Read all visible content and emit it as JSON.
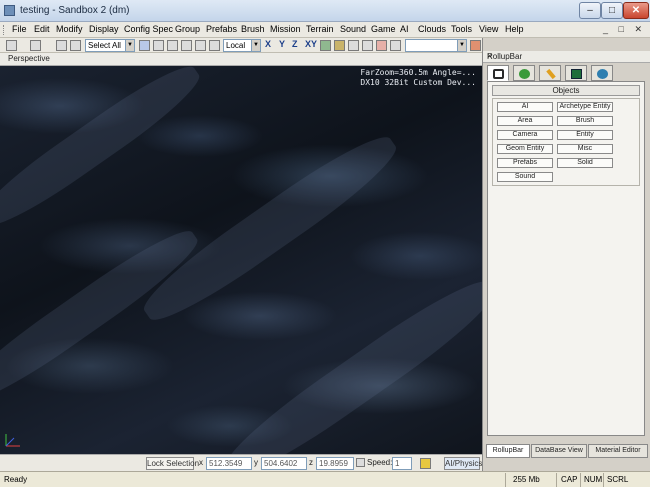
{
  "window": {
    "title": "testing - Sandbox 2 (dm)",
    "min": "–",
    "max": "□",
    "close": "✕"
  },
  "menu": [
    "File",
    "Edit",
    "Modify",
    "Display",
    "Config Spec",
    "Group",
    "Prefabs",
    "Brush",
    "Mission",
    "Terrain",
    "Sound",
    "Game",
    "AI",
    "Clouds",
    "Tools",
    "View",
    "Help"
  ],
  "mdi_buttons": "_ □ ✕",
  "toolbar": {
    "select_combo": "Select All",
    "layer_combo": "Local",
    "axis_x": "X",
    "axis_y": "Y",
    "axis_z": "Z",
    "axis_xy": "XY"
  },
  "viewport": {
    "label": "Perspective",
    "hud_line1": "FarZoom=360.5m  Angle=...",
    "hud_line2": "DX10  32Bit  Custom Dev..."
  },
  "bottombar": {
    "lock_selection": "Lock Selection",
    "x_label": "x",
    "x_value": "512.3549",
    "y_label": "y",
    "y_value": "504.6402",
    "z_label": "z",
    "z_value": "19.8959",
    "speed_label": "Speed:",
    "speed_value": "1",
    "ai_physics": "AI/Physics"
  },
  "status": {
    "ready": "Ready",
    "memory": "255 Mb",
    "cap": "CAP",
    "num": "NUM",
    "scrl": "SCRL"
  },
  "rollup": {
    "title": "RollupBar",
    "close": "×",
    "tabs": [
      {
        "icon": "objects-icon",
        "color": "#2a2a2a"
      },
      {
        "icon": "terrain-icon",
        "color": "#3a9a3a"
      },
      {
        "icon": "modify-icon",
        "color": "#e0a020"
      },
      {
        "icon": "display-icon",
        "color": "#1e6e3a"
      },
      {
        "icon": "layers-icon",
        "color": "#2f7fb0"
      }
    ],
    "objects_header": "Objects",
    "object_buttons": [
      "AI",
      "Archetype Entity",
      "Area",
      "Brush",
      "Camera",
      "Entity",
      "Geom Entity",
      "Misc",
      "Prefabs",
      "Solid",
      "Sound"
    ],
    "bottom_tabs": [
      "RollupBar",
      "DataBase View",
      "Material Editor"
    ]
  }
}
